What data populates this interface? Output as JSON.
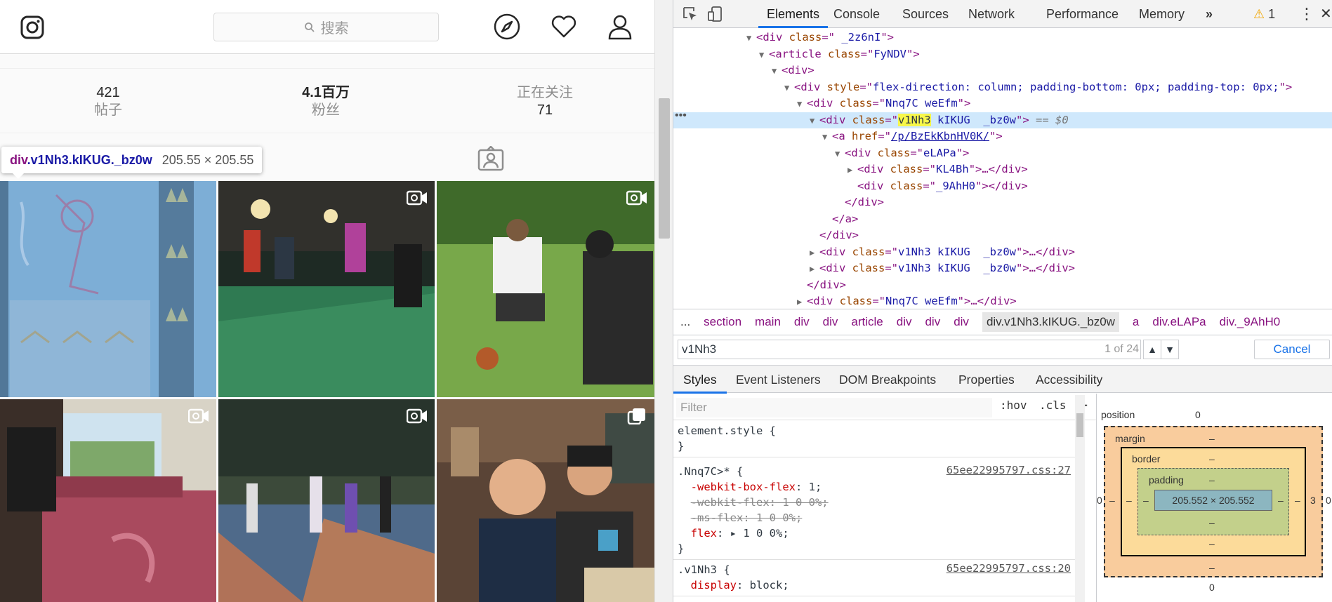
{
  "instagram": {
    "search_placeholder": "搜索",
    "stats": [
      {
        "num": "421",
        "label": "帖子"
      },
      {
        "num": "4.1百万",
        "label": "粉丝"
      },
      {
        "label": "正在关注",
        "num": "71"
      }
    ],
    "tooltip": {
      "selector_tag": "div",
      "selector_classes": ".v1Nh3.kIKUG._bz0w",
      "size": "205.55 × 205.55"
    },
    "icons": [
      "instagram-logo-icon",
      "search-icon",
      "explore-compass-icon",
      "heart-icon",
      "profile-icon",
      "tagged-icon",
      "video-icon",
      "carousel-icon"
    ]
  },
  "devtools": {
    "tabs": [
      "Elements",
      "Console",
      "Sources",
      "Network",
      "Performance",
      "Memory"
    ],
    "more_tabs": "»",
    "warnings": "1",
    "dom": [
      {
        "indent": 0,
        "open": true,
        "html": [
          [
            "t",
            "<div "
          ],
          [
            "an",
            "class"
          ],
          [
            "t",
            "=\""
          ],
          [
            "av",
            " _2z6nI"
          ],
          [
            "t",
            "\">"
          ]
        ]
      },
      {
        "indent": 1,
        "open": true,
        "html": [
          [
            "t",
            "<article "
          ],
          [
            "an",
            "class"
          ],
          [
            "t",
            "=\""
          ],
          [
            "av",
            "FyNDV"
          ],
          [
            "t",
            "\">"
          ]
        ]
      },
      {
        "indent": 2,
        "open": true,
        "html": [
          [
            "t",
            "<div>"
          ]
        ]
      },
      {
        "indent": 3,
        "open": true,
        "html": [
          [
            "t",
            "<div "
          ],
          [
            "an",
            "style"
          ],
          [
            "t",
            "=\""
          ],
          [
            "av",
            "flex-direction: column; padding-bottom: 0px; padding-top: 0px;"
          ],
          [
            "t",
            "\">"
          ]
        ]
      },
      {
        "indent": 4,
        "open": true,
        "html": [
          [
            "t",
            "<div "
          ],
          [
            "an",
            "class"
          ],
          [
            "t",
            "=\""
          ],
          [
            "av",
            "Nnq7C weEfm"
          ],
          [
            "t",
            "\">"
          ]
        ]
      },
      {
        "indent": 5,
        "open": true,
        "sel": true,
        "html": [
          [
            "t",
            "<div "
          ],
          [
            "an",
            "class"
          ],
          [
            "t",
            "=\""
          ],
          [
            "hl",
            "v1Nh3"
          ],
          [
            "av",
            " kIKUG  _bz0w"
          ],
          [
            "t",
            "\">"
          ],
          [
            "eq",
            " == $0"
          ]
        ]
      },
      {
        "indent": 6,
        "open": true,
        "html": [
          [
            "t",
            "<a "
          ],
          [
            "an",
            "href"
          ],
          [
            "t",
            "=\""
          ],
          [
            "lk",
            "/p/BzEkKbnHV0K/"
          ],
          [
            "t",
            "\">"
          ]
        ]
      },
      {
        "indent": 7,
        "open": true,
        "html": [
          [
            "t",
            "<div "
          ],
          [
            "an",
            "class"
          ],
          [
            "t",
            "=\""
          ],
          [
            "av",
            "eLAPa"
          ],
          [
            "t",
            "\">"
          ]
        ]
      },
      {
        "indent": 8,
        "closed": true,
        "html": [
          [
            "t",
            "<div "
          ],
          [
            "an",
            "class"
          ],
          [
            "t",
            "=\""
          ],
          [
            "av",
            "KL4Bh"
          ],
          [
            "t",
            "\">…</div>"
          ]
        ]
      },
      {
        "indent": 8,
        "html": [
          [
            "t",
            "<div "
          ],
          [
            "an",
            "class"
          ],
          [
            "t",
            "=\""
          ],
          [
            "av",
            "_9AhH0"
          ],
          [
            "t",
            "\"></div>"
          ]
        ]
      },
      {
        "indent": 7,
        "html": [
          [
            "t",
            "</div>"
          ]
        ]
      },
      {
        "indent": 6,
        "html": [
          [
            "t",
            "</a>"
          ]
        ]
      },
      {
        "indent": 5,
        "html": [
          [
            "t",
            "</div>"
          ]
        ]
      },
      {
        "indent": 5,
        "closed": true,
        "html": [
          [
            "t",
            "<div "
          ],
          [
            "an",
            "class"
          ],
          [
            "t",
            "=\""
          ],
          [
            "av",
            "v1Nh3 kIKUG  _bz0w"
          ],
          [
            "t",
            "\">…</div>"
          ]
        ]
      },
      {
        "indent": 5,
        "closed": true,
        "html": [
          [
            "t",
            "<div "
          ],
          [
            "an",
            "class"
          ],
          [
            "t",
            "=\""
          ],
          [
            "av",
            "v1Nh3 kIKUG  _bz0w"
          ],
          [
            "t",
            "\">…</div>"
          ]
        ]
      },
      {
        "indent": 4,
        "html": [
          [
            "t",
            "</div>"
          ]
        ]
      },
      {
        "indent": 4,
        "closed": true,
        "html": [
          [
            "t",
            "<div "
          ],
          [
            "an",
            "class"
          ],
          [
            "t",
            "=\""
          ],
          [
            "av",
            "Nnq7C weEfm"
          ],
          [
            "t",
            "\">…</div>"
          ]
        ]
      }
    ],
    "breadcrumbs": [
      "...",
      "section",
      "main",
      "div",
      "div",
      "article",
      "div",
      "div",
      "div",
      "div.v1Nh3.kIKUG._bz0w",
      "a",
      "div.eLAPa",
      "div._9AhH0"
    ],
    "breadcrumb_selected": 9,
    "search": {
      "value": "v1Nh3",
      "count": "1 of 24",
      "cancel": "Cancel"
    },
    "subtabs": [
      "Styles",
      "Event Listeners",
      "DOM Breakpoints",
      "Properties",
      "Accessibility"
    ],
    "filter": {
      "placeholder": "Filter",
      "hov": ":hov",
      "cls": ".cls",
      "add": "+"
    },
    "rules": [
      {
        "lines": [
          [
            "element.style {"
          ],
          [
            "}"
          ]
        ]
      },
      {
        "src": "65ee22995797.css:27",
        "lines": [
          [
            ".Nnq7C>* {"
          ],
          [
            "  ",
            [
              "prop",
              "-webkit-box-flex"
            ],
            ": 1;"
          ],
          [
            "  ",
            [
              "strike",
              "-webkit-flex: 1 0 0%;"
            ]
          ],
          [
            "  ",
            [
              "strike",
              "-ms-flex: 1 0 0%;"
            ]
          ],
          [
            "  ",
            [
              "prop",
              "flex"
            ],
            ": ▸ 1 0 0%;"
          ],
          [
            "}"
          ]
        ]
      },
      {
        "src": "65ee22995797.css:20",
        "lines": [
          [
            ".v1Nh3 {"
          ],
          [
            "  ",
            [
              "prop",
              "display"
            ],
            ": block;"
          ]
        ]
      }
    ],
    "boxmodel": {
      "position_label": "position",
      "position_value": "0",
      "margin_label": "margin",
      "margin_value": "–",
      "border_label": "border",
      "border_value": "–",
      "padding_label": "padding",
      "padding_value": "–",
      "content": "205.552 × 205.552",
      "left_outer": "0",
      "right_outer": "0",
      "right_margin": "3",
      "left_margin": "–",
      "bottom_outer": "0"
    },
    "colors": {
      "accent": "#1a73e8",
      "tag": "#881280",
      "attr_name": "#994500",
      "attr_value": "#1a1aa6",
      "highlight": "#f7f74a",
      "selected_row": "#cfe8fc"
    }
  }
}
